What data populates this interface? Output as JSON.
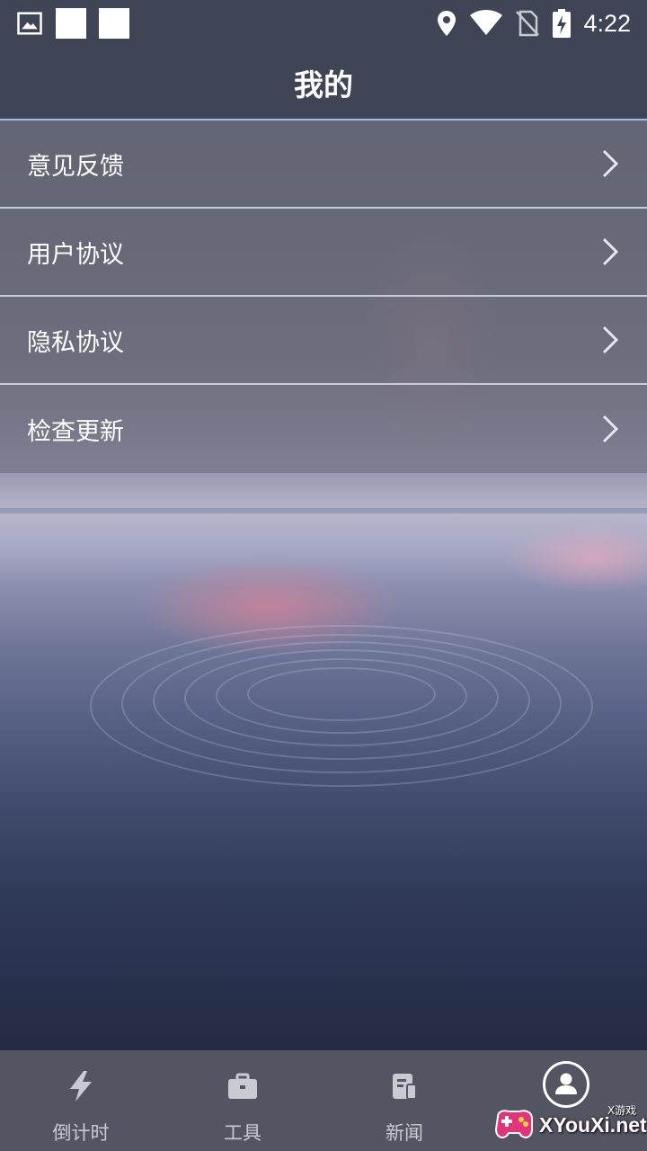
{
  "status_bar": {
    "time": "4:22",
    "icons": [
      "image-icon",
      "notification-square",
      "notification-square",
      "location-icon",
      "wifi-icon",
      "no-sim-icon",
      "battery-charging-icon"
    ]
  },
  "app_bar": {
    "title": "我的"
  },
  "menu": {
    "items": [
      {
        "label": "意见反馈",
        "icon": "chevron-right-icon"
      },
      {
        "label": "用户协议",
        "icon": "chevron-right-icon"
      },
      {
        "label": "隐私协议",
        "icon": "chevron-right-icon"
      },
      {
        "label": "检查更新",
        "icon": "chevron-right-icon"
      }
    ]
  },
  "bottom_nav": {
    "items": [
      {
        "label": "倒计时",
        "icon": "bolt-icon"
      },
      {
        "label": "工具",
        "icon": "briefcase-icon"
      },
      {
        "label": "新闻",
        "icon": "news-icon"
      },
      {
        "label": "",
        "icon": "profile-icon",
        "active": true
      }
    ]
  },
  "watermark": {
    "text": "XYouXi.net",
    "small_text": "X游戏"
  },
  "colors": {
    "accent_line": "#a9b7e0",
    "bar_bg": "#3f4454",
    "nav_bg": "#555864"
  }
}
